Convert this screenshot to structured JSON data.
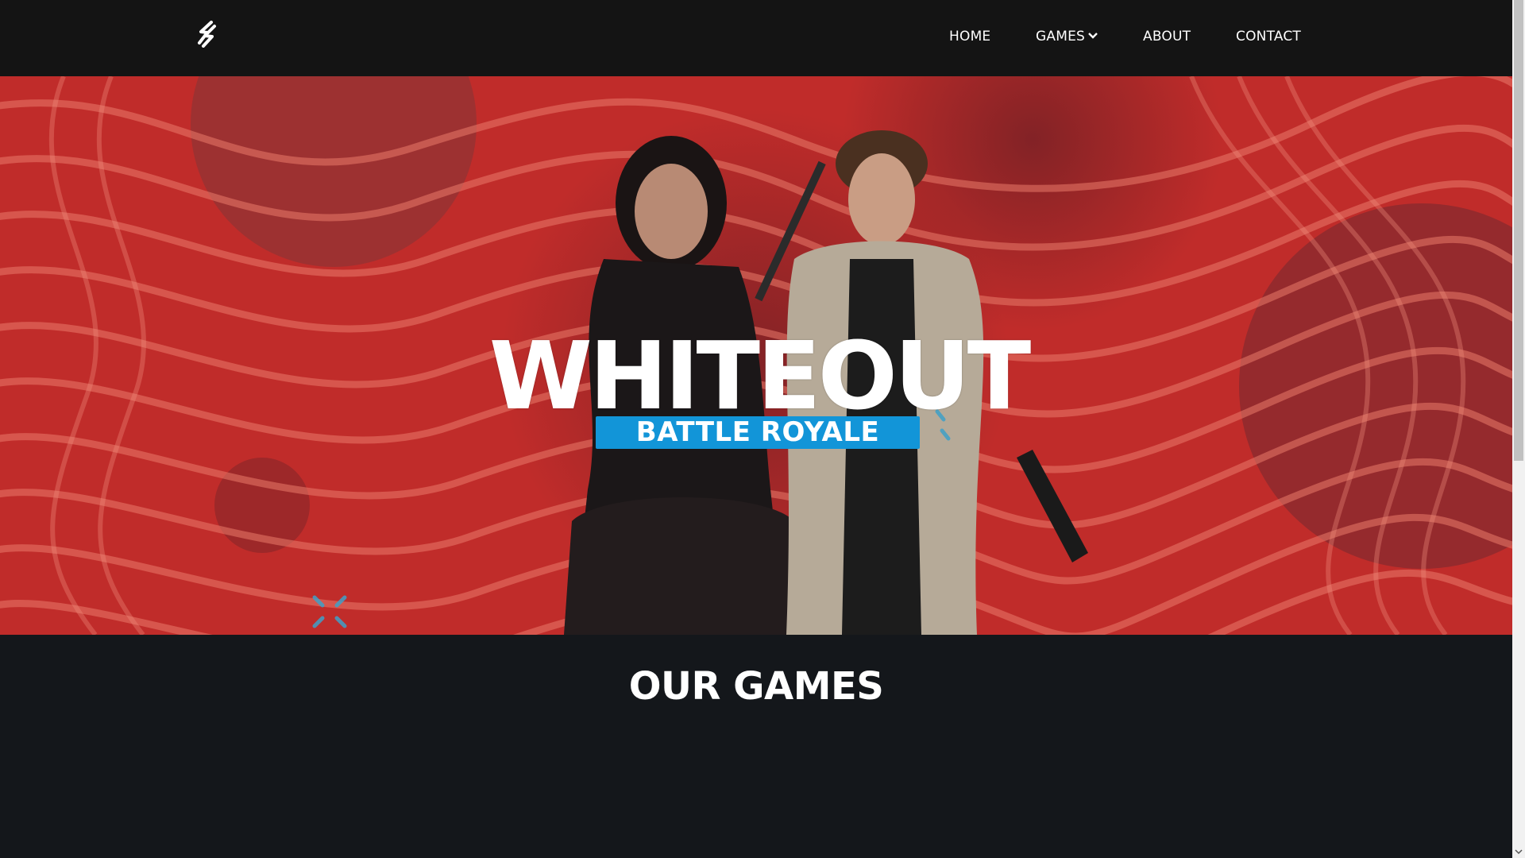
{
  "nav": {
    "logo": "lightning-logo",
    "items": [
      {
        "label": "HOME"
      },
      {
        "label": "GAMES",
        "icon": "chevron-down-icon"
      },
      {
        "label": "ABOUT"
      },
      {
        "label": "CONTACT"
      }
    ]
  },
  "hero": {
    "title": "WHITEOUT",
    "subtitle": "BATTLE ROYALE",
    "colors": {
      "background": "#b42525",
      "subtitle_bg": "#1295d8"
    }
  },
  "section": {
    "title": "OUR GAMES"
  }
}
